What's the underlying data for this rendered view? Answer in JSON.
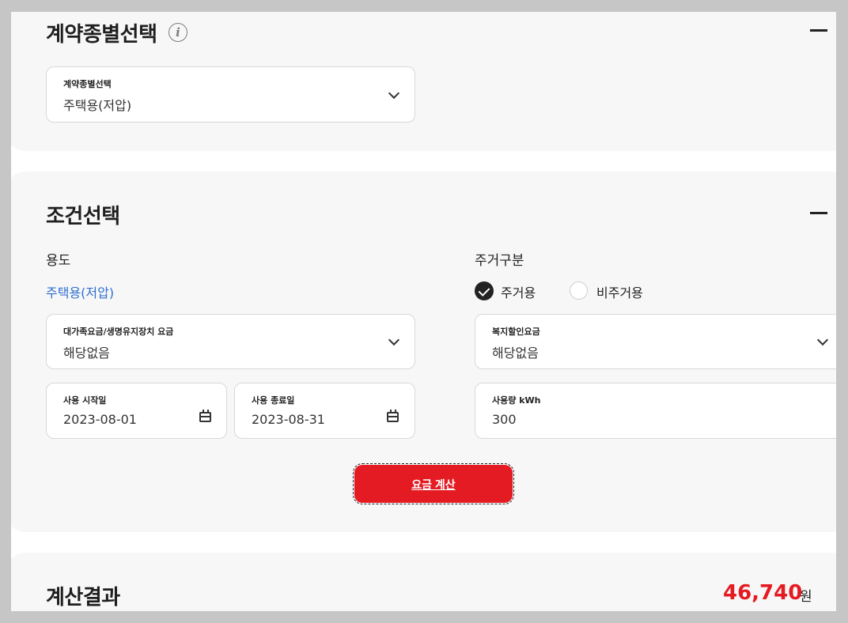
{
  "contract_section": {
    "title": "계약종별선택",
    "select": {
      "label": "계약종별선택",
      "value": "주택용(저압)"
    }
  },
  "condition_section": {
    "title": "조건선택",
    "usage": {
      "label": "용도",
      "value": "주택용(저압)"
    },
    "residence": {
      "label": "주거구분",
      "options": [
        {
          "label": "주거용",
          "checked": true
        },
        {
          "label": "비주거용",
          "checked": false
        }
      ]
    },
    "large_family": {
      "label": "대가족요금/생명유지장치 요금",
      "value": "해당없음"
    },
    "welfare": {
      "label": "복지할인요금",
      "value": "해당없음"
    },
    "start_date": {
      "label": "사용 시작일",
      "value": "2023-08-01"
    },
    "end_date": {
      "label": "사용 종료일",
      "value": "2023-08-31"
    },
    "kwh": {
      "label": "사용량 kWh",
      "value": "300"
    },
    "calc_button": "요금 계산"
  },
  "result_section": {
    "title": "계산결과",
    "amount": "46,740",
    "unit": "원"
  },
  "colors": {
    "accent_red": "#e51b23",
    "link_blue": "#2e6fd1",
    "card_bg": "#f7f7f7"
  }
}
